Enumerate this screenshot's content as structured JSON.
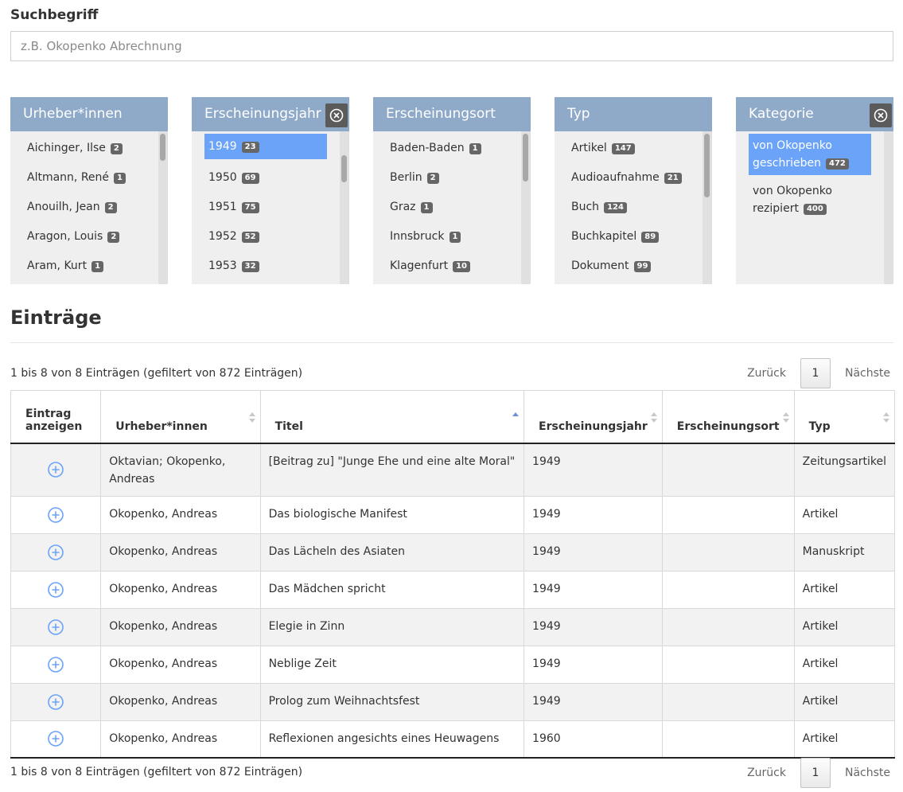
{
  "search": {
    "label": "Suchbegriff",
    "placeholder": "z.B. Okopenko Abrechnung",
    "value": ""
  },
  "facets": [
    {
      "title": "Urheber*innen",
      "clearable": false,
      "items": [
        {
          "label": "Aichinger, Ilse",
          "count": "2"
        },
        {
          "label": "Altmann, René",
          "count": "1"
        },
        {
          "label": "Anouilh, Jean",
          "count": "2"
        },
        {
          "label": "Aragon, Louis",
          "count": "2"
        },
        {
          "label": "Aram, Kurt",
          "count": "1"
        }
      ]
    },
    {
      "title": "Erscheinungsjahr",
      "clearable": true,
      "items": [
        {
          "label": "1949",
          "count": "23",
          "selected": true
        },
        {
          "label": "1950",
          "count": "69"
        },
        {
          "label": "1951",
          "count": "75"
        },
        {
          "label": "1952",
          "count": "52"
        },
        {
          "label": "1953",
          "count": "32"
        }
      ]
    },
    {
      "title": "Erscheinungsort",
      "clearable": false,
      "items": [
        {
          "label": "Baden-Baden",
          "count": "1"
        },
        {
          "label": "Berlin",
          "count": "2"
        },
        {
          "label": "Graz",
          "count": "1"
        },
        {
          "label": "Innsbruck",
          "count": "1"
        },
        {
          "label": "Klagenfurt",
          "count": "10"
        }
      ]
    },
    {
      "title": "Typ",
      "clearable": false,
      "items": [
        {
          "label": "Artikel",
          "count": "147"
        },
        {
          "label": "Audioaufnahme",
          "count": "21"
        },
        {
          "label": "Buch",
          "count": "124"
        },
        {
          "label": "Buchkapitel",
          "count": "89"
        },
        {
          "label": "Dokument",
          "count": "99"
        }
      ]
    },
    {
      "title": "Kategorie",
      "clearable": true,
      "items": [
        {
          "label": "von Okopenko geschrieben",
          "count": "472",
          "selected": true
        },
        {
          "label": "von Okopenko rezipiert",
          "count": "400"
        }
      ]
    }
  ],
  "entries": {
    "title": "Einträge",
    "info": "1 bis 8 von 8 Einträgen (gefiltert von 872 Einträgen)",
    "pager": {
      "prev": "Zurück",
      "page": "1",
      "next": "Nächste"
    },
    "columns": [
      "Eintrag anzeigen",
      "Urheber*innen",
      "Titel",
      "Erscheinungsjahr",
      "Erscheinungsort",
      "Typ"
    ],
    "sorted_column": "Titel",
    "rows": [
      {
        "author": "Oktavian; Okopenko, Andreas",
        "title": "[Beitrag zu] \"Junge Ehe und eine alte Moral\"",
        "year": "1949",
        "place": "",
        "type": "Zeitungsartikel"
      },
      {
        "author": "Okopenko, Andreas",
        "title": "Das biologische Manifest",
        "year": "1949",
        "place": "",
        "type": "Artikel"
      },
      {
        "author": "Okopenko, Andreas",
        "title": "Das Lächeln des Asiaten",
        "year": "1949",
        "place": "",
        "type": "Manuskript"
      },
      {
        "author": "Okopenko, Andreas",
        "title": "Das Mädchen spricht",
        "year": "1949",
        "place": "",
        "type": "Artikel"
      },
      {
        "author": "Okopenko, Andreas",
        "title": "Elegie in Zinn",
        "year": "1949",
        "place": "",
        "type": "Artikel"
      },
      {
        "author": "Okopenko, Andreas",
        "title": "Neblige Zeit",
        "year": "1949",
        "place": "",
        "type": "Artikel"
      },
      {
        "author": "Okopenko, Andreas",
        "title": "Prolog zum Weihnachtsfest",
        "year": "1949",
        "place": "",
        "type": "Artikel"
      },
      {
        "author": "Okopenko, Andreas",
        "title": "Reflexionen angesichts eines Heuwagens",
        "year": "1960",
        "place": "",
        "type": "Artikel"
      }
    ]
  },
  "colors": {
    "facet_header": "#8fa9c9",
    "selected": "#6aa3f8",
    "expand_icon": "#6aa3f8"
  },
  "icons": {
    "clear": "circle-x-icon",
    "expand": "circle-plus-icon"
  }
}
